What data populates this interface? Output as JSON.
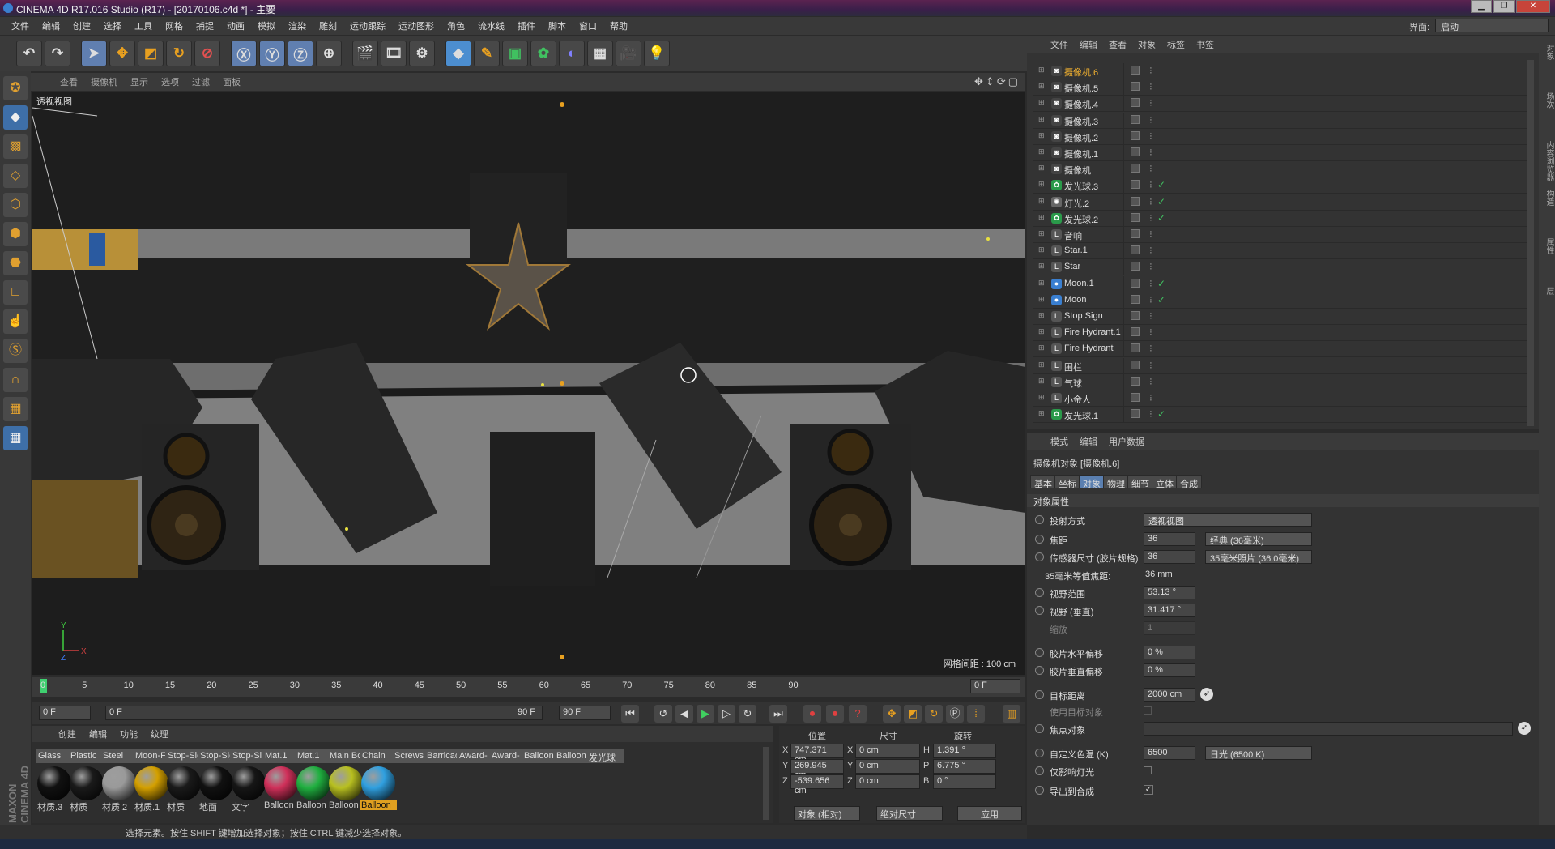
{
  "window": {
    "title": "CINEMA 4D R17.016 Studio (R17) - [20170106.c4d *] - 主要"
  },
  "menu": [
    "文件",
    "编辑",
    "创建",
    "选择",
    "工具",
    "网格",
    "捕捉",
    "动画",
    "模拟",
    "渲染",
    "雕刻",
    "运动跟踪",
    "运动图形",
    "角色",
    "流水线",
    "插件",
    "脚本",
    "窗口",
    "帮助"
  ],
  "layout": {
    "label": "界面:",
    "value": "启动"
  },
  "viewport": {
    "menu": [
      "查看",
      "摄像机",
      "显示",
      "选项",
      "过滤",
      "面板"
    ],
    "label": "透视视图",
    "grid_info": "网格间距 : 100 cm"
  },
  "timeline": {
    "ticks": [
      "0",
      "5",
      "10",
      "15",
      "20",
      "25",
      "30",
      "35",
      "40",
      "45",
      "50",
      "55",
      "60",
      "65",
      "70",
      "75",
      "80",
      "85",
      "90"
    ],
    "current_frame": "0 F",
    "start": "0 F",
    "range_start": "0 F",
    "range_end": "90 F",
    "end": "90 F"
  },
  "material_menu": [
    "创建",
    "编辑",
    "功能",
    "纹理"
  ],
  "materials": [
    {
      "name": "Glass",
      "label": "材质.3",
      "color": "#111"
    },
    {
      "name": "Plastic M",
      "label": "材质",
      "color": "#1a1a1a"
    },
    {
      "name": "Steel",
      "label": "材质.2",
      "color": "#9a9a9a"
    },
    {
      "name": "Moon-F",
      "label": "材质.1",
      "color": "#d4a000"
    },
    {
      "name": "Stop-Sig",
      "label": "材质",
      "color": "#1a1a1a"
    },
    {
      "name": "Stop-Sig",
      "label": "地面",
      "color": "#111"
    },
    {
      "name": "Stop-Sig",
      "label": "文字",
      "color": "#161616"
    },
    {
      "name": "Mat.1",
      "label": "Balloon",
      "color": "#d0305a"
    },
    {
      "name": "Mat.1",
      "label": "Balloon",
      "color": "#20b040"
    },
    {
      "name": "Main Bc",
      "label": "Balloon",
      "color": "#b8c020"
    },
    {
      "name": "Chain",
      "label": "Balloon",
      "color": "#30a0e0"
    },
    {
      "name": "Screws",
      "label": "",
      "color": ""
    },
    {
      "name": "Barricac",
      "label": "",
      "color": ""
    },
    {
      "name": "Award-",
      "label": "",
      "color": ""
    },
    {
      "name": "Award-",
      "label": "",
      "color": ""
    },
    {
      "name": "Balloon",
      "label": "",
      "color": ""
    },
    {
      "name": "Balloon",
      "label": "",
      "color": ""
    },
    {
      "name": "发光球",
      "label": "",
      "color": ""
    }
  ],
  "coords": {
    "headers": [
      "位置",
      "尺寸",
      "旋转"
    ],
    "rows": [
      {
        "axis": "X",
        "pos": "747.371 cm",
        "size": "0 cm",
        "rl": "H",
        "rot": "1.391 °"
      },
      {
        "axis": "Y",
        "pos": "269.945 cm",
        "size": "0 cm",
        "rl": "P",
        "rot": "6.775 °"
      },
      {
        "axis": "Z",
        "pos": "-539.656 cm",
        "size": "0 cm",
        "rl": "B",
        "rot": "0 °"
      }
    ],
    "mode": "对象 (相对)",
    "size_mode": "绝对尺寸",
    "apply": "应用"
  },
  "status": "选择元素。按住 SHIFT 键增加选择对象；按住 CTRL 键减少选择对象。",
  "objects_menu": [
    "文件",
    "编辑",
    "查看",
    "对象",
    "标签",
    "书签"
  ],
  "objects": [
    {
      "name": "摄像机.6",
      "icon": "camera",
      "selected": true
    },
    {
      "name": "摄像机.5",
      "icon": "camera"
    },
    {
      "name": "摄像机.4",
      "icon": "camera"
    },
    {
      "name": "摄像机.3",
      "icon": "camera"
    },
    {
      "name": "摄像机.2",
      "icon": "camera"
    },
    {
      "name": "摄像机.1",
      "icon": "camera"
    },
    {
      "name": "摄像机",
      "icon": "camera"
    },
    {
      "name": "发光球.3",
      "icon": "cloner"
    },
    {
      "name": "灯光.2",
      "icon": "light"
    },
    {
      "name": "发光球.2",
      "icon": "cloner"
    },
    {
      "name": "音响",
      "icon": "null"
    },
    {
      "name": "Star.1",
      "icon": "null"
    },
    {
      "name": "Star",
      "icon": "null"
    },
    {
      "name": "Moon.1",
      "icon": "sphere"
    },
    {
      "name": "Moon",
      "icon": "sphere"
    },
    {
      "name": "Stop Sign",
      "icon": "null"
    },
    {
      "name": "Fire Hydrant.1",
      "icon": "null"
    },
    {
      "name": "Fire Hydrant",
      "icon": "null"
    },
    {
      "name": "围栏",
      "icon": "null"
    },
    {
      "name": "气球",
      "icon": "null"
    },
    {
      "name": "小金人",
      "icon": "null"
    },
    {
      "name": "发光球.1",
      "icon": "cloner"
    }
  ],
  "attr_menu": [
    "模式",
    "编辑",
    "用户数据"
  ],
  "attr_title": "摄像机对象 [摄像机.6]",
  "attr_tabs": [
    "基本",
    "坐标",
    "对象",
    "物理",
    "细节",
    "立体",
    "合成"
  ],
  "attr_section": "对象属性",
  "attrs": {
    "projection": {
      "label": "投射方式",
      "value": "透视视图"
    },
    "focal": {
      "label": "焦距",
      "value": "36",
      "preset": "经典 (36毫米)"
    },
    "sensor": {
      "label": "传感器尺寸 (胶片规格)",
      "value": "36",
      "preset": "35毫米照片 (36.0毫米)"
    },
    "equiv": {
      "label": "35毫米等值焦距:",
      "value": "36 mm"
    },
    "fov": {
      "label": "视野范围",
      "value": "53.13 °"
    },
    "fov_v": {
      "label": "视野 (垂直)",
      "value": "31.417 °"
    },
    "zoom": {
      "label": "缩放",
      "value": "1"
    },
    "film_h": {
      "label": "胶片水平偏移",
      "value": "0 %"
    },
    "film_v": {
      "label": "胶片垂直偏移",
      "value": "0 %"
    },
    "target_dist": {
      "label": "目标距离",
      "value": "2000 cm"
    },
    "use_target": {
      "label": "使用目标对象"
    },
    "focus_obj": {
      "label": "焦点对象"
    },
    "color_temp": {
      "label": "自定义色温 (K)",
      "value": "6500",
      "preset": "日光 (6500 K)"
    },
    "light_only": {
      "label": "仅影响灯光"
    },
    "export": {
      "label": "导出到合成"
    }
  },
  "right_tabs": [
    "对象",
    "场次",
    "内容浏览器",
    "构造",
    "属性",
    "层"
  ],
  "brand": "MAXON CINEMA 4D"
}
